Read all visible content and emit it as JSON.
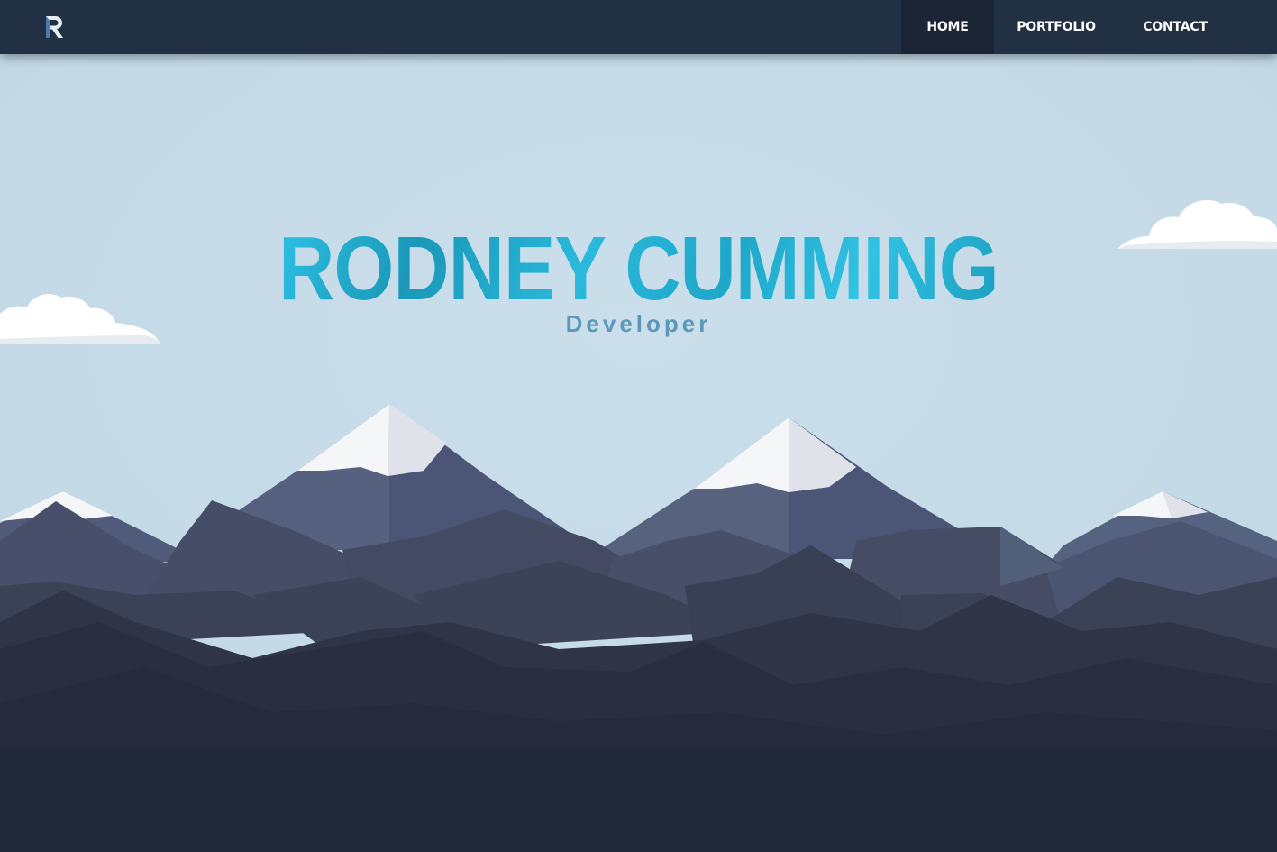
{
  "header": {
    "logo_letter": "R",
    "nav": [
      {
        "label": "HOME",
        "active": true
      },
      {
        "label": "PORTFOLIO",
        "active": false
      },
      {
        "label": "CONTACT",
        "active": false
      }
    ]
  },
  "hero": {
    "title": "RODNEY CUMMING",
    "subtitle": "Developer"
  },
  "colors": {
    "navbar": "#223044",
    "sky": "#c6dbe7",
    "title": "#26b3d6",
    "subtitle": "#5b98b9",
    "ground": "#202738"
  }
}
